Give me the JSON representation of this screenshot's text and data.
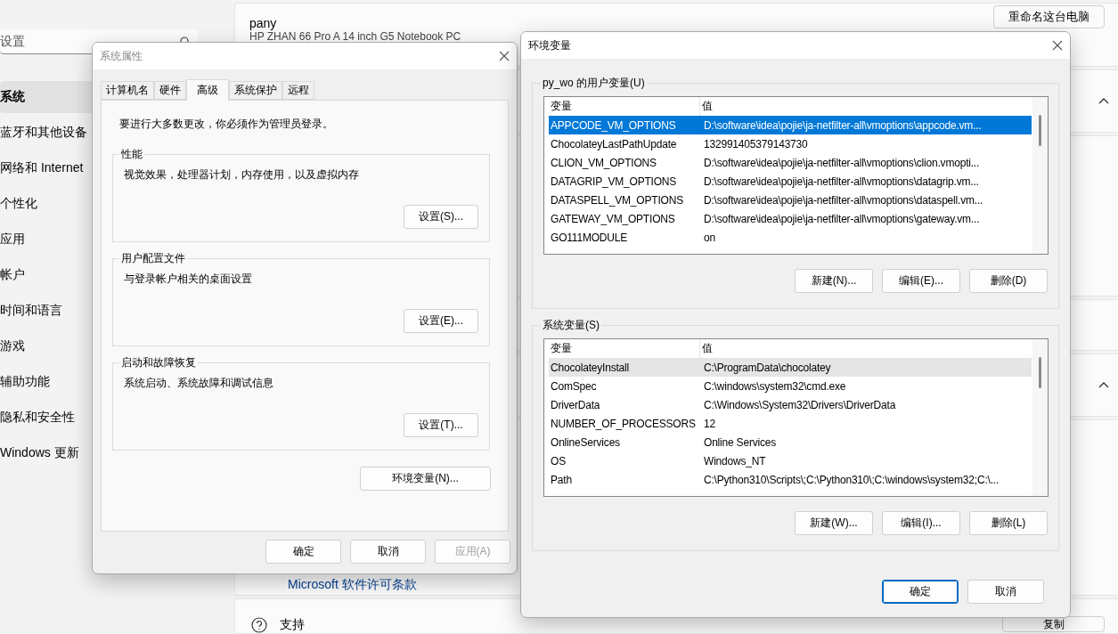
{
  "settings": {
    "search": {
      "placeholder": "设置"
    },
    "nav": [
      {
        "label": "系统",
        "selected": true
      },
      {
        "label": "蓝牙和其他设备",
        "selected": false
      },
      {
        "label": "网络和 Internet",
        "selected": false
      },
      {
        "label": "个性化",
        "selected": false
      },
      {
        "label": "应用",
        "selected": false
      },
      {
        "label": "帐户",
        "selected": false
      },
      {
        "label": "时间和语言",
        "selected": false
      },
      {
        "label": "游戏",
        "selected": false
      },
      {
        "label": "辅助功能",
        "selected": false
      },
      {
        "label": "隐私和安全性",
        "selected": false
      },
      {
        "label": "Windows 更新",
        "selected": false
      }
    ],
    "device": {
      "name": "pany",
      "model": "HP ZHAN 66 Pro A 14 inch G5 Notebook PC"
    },
    "rename_button": "重命名这台电脑",
    "license_link": "Microsoft 软件许可条款",
    "support_label": "支持",
    "copy_button": "复制"
  },
  "system_properties": {
    "title": "系统属性",
    "active": false,
    "tabs": [
      {
        "label": "计算机名",
        "selected": false
      },
      {
        "label": "硬件",
        "selected": false
      },
      {
        "label": "高级",
        "selected": true
      },
      {
        "label": "系统保护",
        "selected": false
      },
      {
        "label": "远程",
        "selected": false
      }
    ],
    "notice": "要进行大多数更改，你必须作为管理员登录。",
    "groups": [
      {
        "title": "性能",
        "description": "视觉效果，处理器计划，内存使用，以及虚拟内存",
        "button": "设置(S)..."
      },
      {
        "title": "用户配置文件",
        "description": "与登录帐户相关的桌面设置",
        "button": "设置(E)..."
      },
      {
        "title": "启动和故障恢复",
        "description": "系统启动、系统故障和调试信息",
        "button": "设置(T)..."
      }
    ],
    "env_button": "环境变量(N)...",
    "buttons": [
      {
        "label": "确定",
        "disabled": false
      },
      {
        "label": "取消",
        "disabled": false
      },
      {
        "label": "应用(A)",
        "disabled": true
      }
    ]
  },
  "environment_variables": {
    "title": "环境变量",
    "active": true,
    "sections": [
      {
        "title": "py_wo 的用户变量(U)",
        "focused": true,
        "columns": [
          "变量",
          "值"
        ],
        "rows": [
          {
            "name": "APPCODE_VM_OPTIONS",
            "value": "D:\\software\\idea\\pojie\\ja-netfilter-all\\vmoptions\\appcode.vm...",
            "selected": true
          },
          {
            "name": "ChocolateyLastPathUpdate",
            "value": "132991405379143730",
            "selected": false
          },
          {
            "name": "CLION_VM_OPTIONS",
            "value": "D:\\software\\idea\\pojie\\ja-netfilter-all\\vmoptions\\clion.vmopti...",
            "selected": false
          },
          {
            "name": "DATAGRIP_VM_OPTIONS",
            "value": "D:\\software\\idea\\pojie\\ja-netfilter-all\\vmoptions\\datagrip.vm...",
            "selected": false
          },
          {
            "name": "DATASPELL_VM_OPTIONS",
            "value": "D:\\software\\idea\\pojie\\ja-netfilter-all\\vmoptions\\dataspell.vm...",
            "selected": false
          },
          {
            "name": "GATEWAY_VM_OPTIONS",
            "value": "D:\\software\\idea\\pojie\\ja-netfilter-all\\vmoptions\\gateway.vm...",
            "selected": false
          },
          {
            "name": "GO111MODULE",
            "value": "on",
            "selected": false
          }
        ],
        "buttons": [
          "新建(N)...",
          "编辑(E)...",
          "删除(D)"
        ]
      },
      {
        "title": "系统变量(S)",
        "focused": false,
        "columns": [
          "变量",
          "值"
        ],
        "rows": [
          {
            "name": "ChocolateyInstall",
            "value": "C:\\ProgramData\\chocolatey",
            "selected": true
          },
          {
            "name": "ComSpec",
            "value": "C:\\windows\\system32\\cmd.exe",
            "selected": false
          },
          {
            "name": "DriverData",
            "value": "C:\\Windows\\System32\\Drivers\\DriverData",
            "selected": false
          },
          {
            "name": "NUMBER_OF_PROCESSORS",
            "value": "12",
            "selected": false
          },
          {
            "name": "OnlineServices",
            "value": "Online Services",
            "selected": false
          },
          {
            "name": "OS",
            "value": "Windows_NT",
            "selected": false
          },
          {
            "name": "Path",
            "value": "C:\\Python310\\Scripts\\;C:\\Python310\\;C:\\windows\\system32;C:\\...",
            "selected": false
          }
        ],
        "buttons": [
          "新建(W)...",
          "编辑(I)...",
          "删除(L)"
        ]
      }
    ],
    "buttons": [
      {
        "label": "确定",
        "default": true
      },
      {
        "label": "取消",
        "default": false
      }
    ]
  }
}
